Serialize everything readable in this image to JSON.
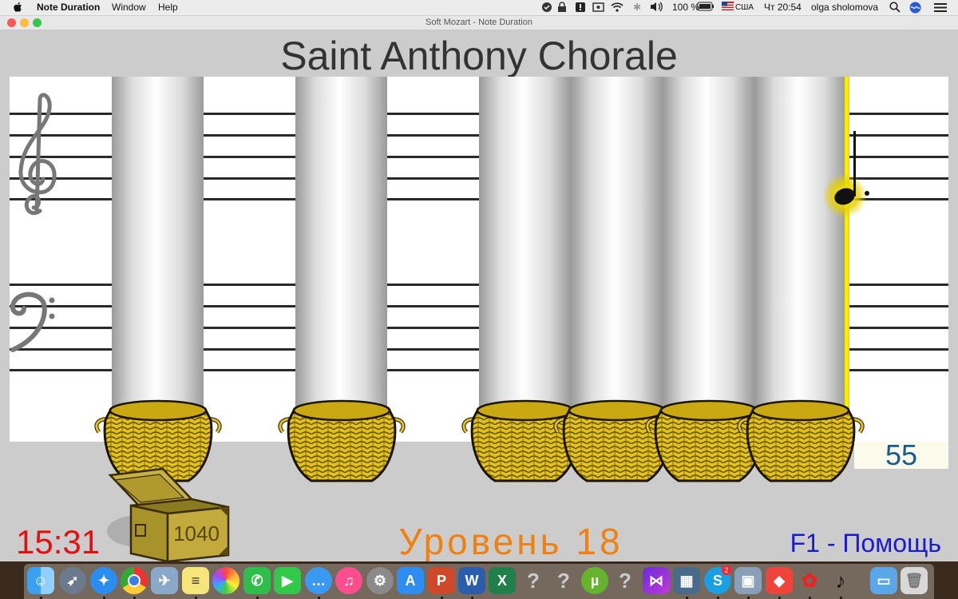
{
  "menubar": {
    "apple_icon": "apple-icon",
    "app_name": "Note Duration",
    "items": [
      "Window",
      "Help"
    ],
    "battery": "100 %",
    "locale": "США",
    "clock": "Чт 20:54",
    "user": "olga sholomova"
  },
  "window": {
    "title": "Soft Mozart - Note Duration"
  },
  "game": {
    "song_title": "Saint Anthony Chorale",
    "score": "55",
    "chest_value": "1040",
    "timer": "15:31",
    "level": "Уровень 18",
    "help": "F1 - Помощь"
  },
  "colors": {
    "timer": "#e31010",
    "level": "#f08010",
    "help": "#1a1ad0",
    "score": "#1c5a8a",
    "cursor_line": "#fff200",
    "basket": "#e2c21c"
  },
  "dock": {
    "apps": [
      "finder-icon",
      "launchpad-icon",
      "safari-icon",
      "chrome-icon",
      "preview-icon",
      "notes-icon",
      "photos-icon",
      "whatsapp-icon",
      "facetime-icon",
      "messages-icon",
      "itunes-icon",
      "system-preferences-icon",
      "app-store-icon",
      "powerpoint-icon",
      "word-icon",
      "excel-icon",
      "unknown-app-icon",
      "unknown-app-icon",
      "utorrent-icon",
      "unknown-app-icon",
      "visual-studio-icon",
      "parallels-icon",
      "skype-icon",
      "photo-browser-icon",
      "anydesk-icon",
      "soft-mozart-icon",
      "note-duration-icon",
      "downloads-folder-icon",
      "trash-icon"
    ],
    "skype_badge": "2"
  }
}
